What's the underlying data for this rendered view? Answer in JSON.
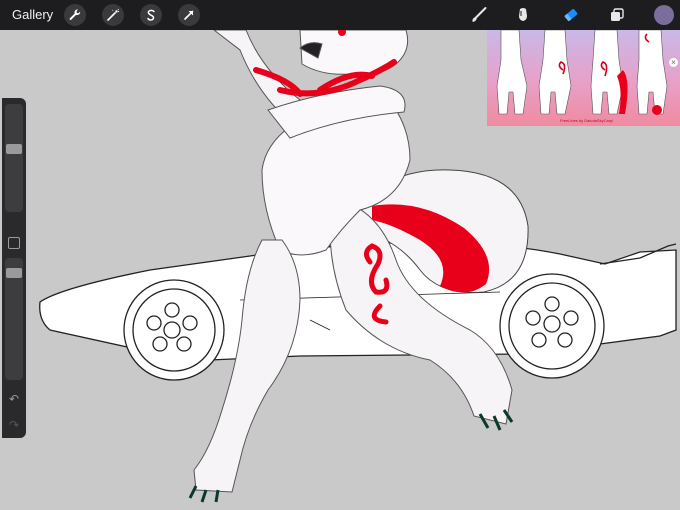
{
  "toolbar": {
    "gallery_label": "Gallery",
    "tools": [
      "wrench-icon",
      "magic-wand-icon",
      "selection-icon",
      "transform-arrow-icon"
    ],
    "right_tools": [
      "brush-icon",
      "smudge-icon",
      "eraser-icon",
      "layers-icon"
    ],
    "active_tool": "eraser-icon",
    "active_tool_color": "#1a8cff",
    "current_color": "#7b6d9c"
  },
  "sidebar": {
    "brush_size_slider": "brush-size",
    "opacity_slider": "brush-opacity",
    "undo_icon": "undo-icon",
    "redo_icon": "redo-icon"
  },
  "reference": {
    "caption": "FreeLines by DakotaSkyCaryl"
  },
  "canvas": {
    "accent_color": "#e8001a",
    "background": "#c9c9c9"
  }
}
